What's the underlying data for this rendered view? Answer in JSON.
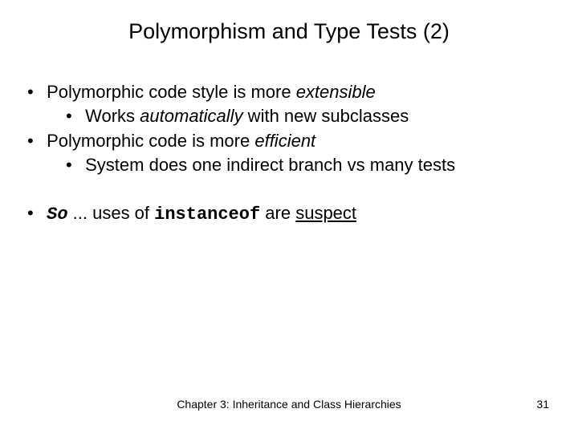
{
  "title": "Polymorphism and Type Tests (2)",
  "bullets": {
    "b1": {
      "pre": "Polymorphic code style is more ",
      "em": "extensible"
    },
    "b1a": {
      "pre": "Works ",
      "em": "automatically",
      "post": " with new subclasses"
    },
    "b2": {
      "pre": "Polymorphic code is more ",
      "em": "efficient"
    },
    "b2a": {
      "text": "System does one indirect branch vs many tests"
    },
    "b3": {
      "so": "So",
      "dots": " ... ",
      "uses": "uses of ",
      "code": "instanceof",
      "are": " are ",
      "suspect": "suspect"
    }
  },
  "footer": "Chapter 3: Inheritance and Class Hierarchies",
  "pagenum": "31"
}
